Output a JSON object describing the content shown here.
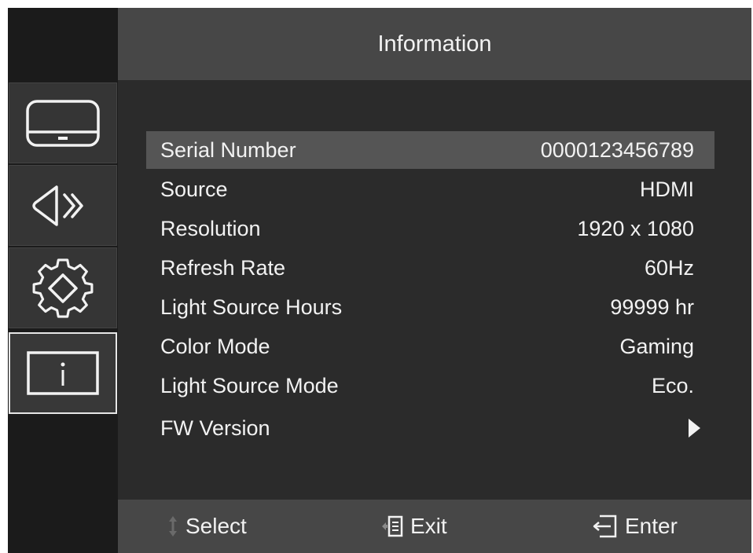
{
  "header": {
    "title": "Information"
  },
  "sidebar": {
    "tabs": [
      {
        "name": "display",
        "icon": "monitor-icon"
      },
      {
        "name": "audio",
        "icon": "speaker-icon"
      },
      {
        "name": "system",
        "icon": "gear-icon"
      },
      {
        "name": "information",
        "icon": "info-icon",
        "active": true
      }
    ]
  },
  "rows": [
    {
      "label": "Serial Number",
      "value": "0000123456789",
      "highlighted": true
    },
    {
      "label": "Source",
      "value": "HDMI"
    },
    {
      "label": "Resolution",
      "value": "1920 x 1080"
    },
    {
      "label": "Refresh Rate",
      "value": "60Hz"
    },
    {
      "label": "Light Source Hours",
      "value": "99999 hr"
    },
    {
      "label": "Color Mode",
      "value": "Gaming"
    },
    {
      "label": "Light Source Mode",
      "value": "Eco."
    },
    {
      "label": "FW Version",
      "icon": "arrow-right-icon"
    }
  ],
  "footer": {
    "select_label": "Select",
    "exit_label": "Exit",
    "enter_label": "Enter"
  },
  "colors": {
    "background": "#2b2b2b",
    "header": "#474747",
    "sidebar": "#1b1b1b",
    "highlight": "#555555",
    "text": "#f2f2f2"
  }
}
